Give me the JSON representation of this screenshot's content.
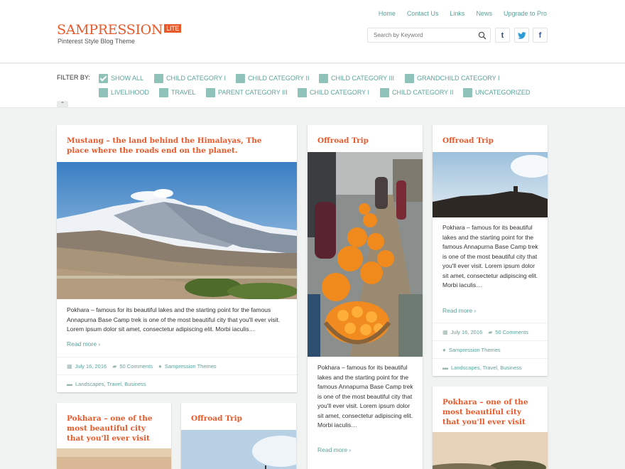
{
  "site": {
    "logo": "SAMPRESSION",
    "badge": "LITE",
    "tagline": "Pinterest Style Blog Theme"
  },
  "nav": [
    "Home",
    "Contact Us",
    "Links",
    "News",
    "Upgrade to Pro"
  ],
  "search": {
    "placeholder": "Search by Keyword"
  },
  "social": [
    "tumblr-icon",
    "twitter-icon",
    "facebook-icon"
  ],
  "filter": {
    "label": "FILTER BY:",
    "items": [
      {
        "label": "SHOW ALL",
        "checked": true
      },
      {
        "label": "CHILD CATEGORY I",
        "checked": false
      },
      {
        "label": "CHILD CATEGORY II",
        "checked": false
      },
      {
        "label": "CHILD CATEGORY III",
        "checked": false
      },
      {
        "label": "GRANDCHILD CATEGORY I",
        "checked": false
      },
      {
        "label": "LIVELIHOOD",
        "checked": false
      },
      {
        "label": "TRAVEL",
        "checked": false
      },
      {
        "label": "PARENT CATEGORY III",
        "checked": false
      },
      {
        "label": "CHILD CATEGORY I",
        "checked": false
      },
      {
        "label": "CHILD CATEGORY II",
        "checked": false
      },
      {
        "label": "UNCATEGORIZED",
        "checked": false
      }
    ],
    "collapse": "⌃"
  },
  "posts": [
    {
      "title": "Mustang – the land behind the Himalayas, The place where the roads end on the planet.",
      "excerpt": "Pokhara – famous for its beautiful lakes and the starting point for the famous Annapurna Base Camp trek is one of the most beautiful city that you'll ever visit.   Lorem ipsum dolor sit amet, consectetur adipiscing elit. Morbi iaculis…",
      "readmore": "Read more ›",
      "date": "July 16, 2016",
      "comments": "50 Comments",
      "categories": "Landscapes, Travel, Business"
    },
    {
      "title": "Offroad Trip",
      "excerpt": "Pokhara – famous for its beautiful lakes and the starting point for the famous Annapurna Base Camp trek is one of the most beautiful city that you'll ever visit. Lorem ipsum dolor sit amet, consectetur adipiscing elit. Morbi iaculis…",
      "readmore": "Read more ›"
    },
    {
      "title": "Offroad Trip",
      "excerpt": "Pokhara – famous for its beautiful lakes and the starting point for the famous Annapurna Base Camp trek is one of the most beautiful city that you'll ever visit. Lorem ipsum dolor sit amet, consectetur adipiscing elit. Morbi iaculis…",
      "readmore": "Read more ›",
      "date": "July 16, 2016",
      "comments": "50 Comments",
      "author": "Sampression Themes",
      "categories": "Landscapes, Travel, Business"
    },
    {
      "title": "Pokhara – one of the most beautiful city that you'll ever visit"
    },
    {
      "title": "Offroad Trip"
    },
    {
      "title": "Pokhara – one of the most beautiful city that you'll ever visit"
    }
  ],
  "author": "Sampression Themes",
  "colors": {
    "accent": "#e9592a",
    "link": "#5aa39a",
    "checkbox": "#8fc2b8"
  }
}
